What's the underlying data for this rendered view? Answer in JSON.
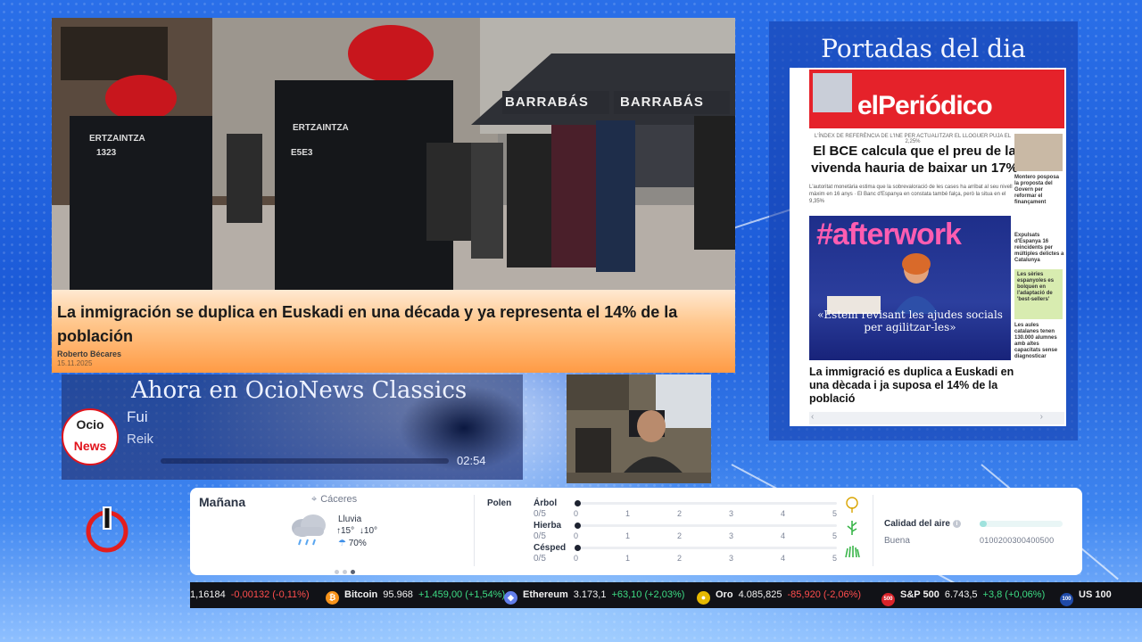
{
  "news": {
    "headline": "La inmigración se duplica en Euskadi en una década y ya representa el 14% de la población",
    "author": "Roberto Bécares",
    "date": "15.11.2025",
    "photo_signs": {
      "bar_sign_1": "BARRABÁS",
      "bar_sign_2": "BARRABÁS",
      "badge_1": "ERTZAINTZA",
      "badge_1_id": "1323",
      "badge_2": "ERTZAINTZA",
      "badge_2_id": "E5E3"
    }
  },
  "portadas": {
    "title": "Portadas del dia",
    "newspaper": {
      "logo": "elPeriódico",
      "strip": "L'ÍNDEX DE REFERÈNCIA DE L'INE PER ACTUALITZAR EL LLOGUER PUJA EL 2,25%",
      "main_headline": "El BCE calcula que el preu de la vivenda hauria de baixar un 17%",
      "main_sub": "L'autoritat monetària estima que la sobrevaloració de les cases ha arribat al seu nivell màxim en 16 anys · El Banc d'Espanya en constata també falça, però la situa en el 9,35%",
      "side": [
        "Montero posposa la proposta del Govern per reformar el finançament",
        "Expulsats d'Espanya 16 reincidents per múltiples delictes a Catalunya",
        "Les sèries espanyoles es bolquen en l'adaptació de 'best-sellers'",
        "Les aules catalanes tenen 130.000 alumnes amb altes capacitats sense diagnosticar"
      ],
      "feature_title": "#afterwork",
      "feature_quote": "«Estem revisant les ajudes socials per agilitzar-les»",
      "second_headline": "La immigració es duplica a Euskadi en una dècada i ja suposa el 14% de la població"
    }
  },
  "now_playing": {
    "title": "Ahora en OcioNews Classics",
    "song": "Fui",
    "artist": "Reik",
    "remaining": "02:54",
    "logo_top": "Ocio",
    "logo_bottom": "News"
  },
  "weather": {
    "day": "Mañana",
    "location": "Cáceres",
    "condition": "Lluvia",
    "temp_high": "15°",
    "temp_low": "10°",
    "rain_prob": "70%",
    "polen_label": "Polen",
    "polen": [
      {
        "name": "Árbol",
        "value": "0/5"
      },
      {
        "name": "Hierba",
        "value": "0/5"
      },
      {
        "name": "Césped",
        "value": "0/5"
      }
    ],
    "polen_scale": [
      "0",
      "1",
      "2",
      "3",
      "4",
      "5"
    ],
    "air_label": "Calidad del aire",
    "air_value": "Buena",
    "air_level_fraction": 0.05,
    "air_scale": "0100200300400500"
  },
  "ticker": [
    {
      "name": "",
      "price": "1,16184",
      "change": "-0,00132 (-0,11%)",
      "dir": "down",
      "icon": "none",
      "color": ""
    },
    {
      "name": "Bitcoin",
      "price": "95.968",
      "change": "+1.459,00 (+1,54%)",
      "dir": "up",
      "icon": "bitcoin-icon",
      "color": "#f7931a"
    },
    {
      "name": "Ethereum",
      "price": "3.173,1",
      "change": "+63,10 (+2,03%)",
      "dir": "up",
      "icon": "ethereum-icon",
      "color": "#627eea"
    },
    {
      "name": "Oro",
      "price": "4.085,825",
      "change": "-85,920 (-2,06%)",
      "dir": "down",
      "icon": "gold-icon",
      "color": "#e6b800"
    },
    {
      "name": "S&P 500",
      "price": "6.743,5",
      "change": "+3,8 (+0,06%)",
      "dir": "up",
      "icon": "sp500-icon",
      "color": "#d8232a",
      "icon_text": "500"
    },
    {
      "name": "US 100",
      "price": "",
      "change": "",
      "dir": "up",
      "icon": "us100-icon",
      "color": "#1f4aa8",
      "icon_text": "100"
    }
  ],
  "colors": {
    "accent_red": "#e5222a",
    "ticker_up": "#3ddc84",
    "ticker_down": "#ff4d4d"
  }
}
